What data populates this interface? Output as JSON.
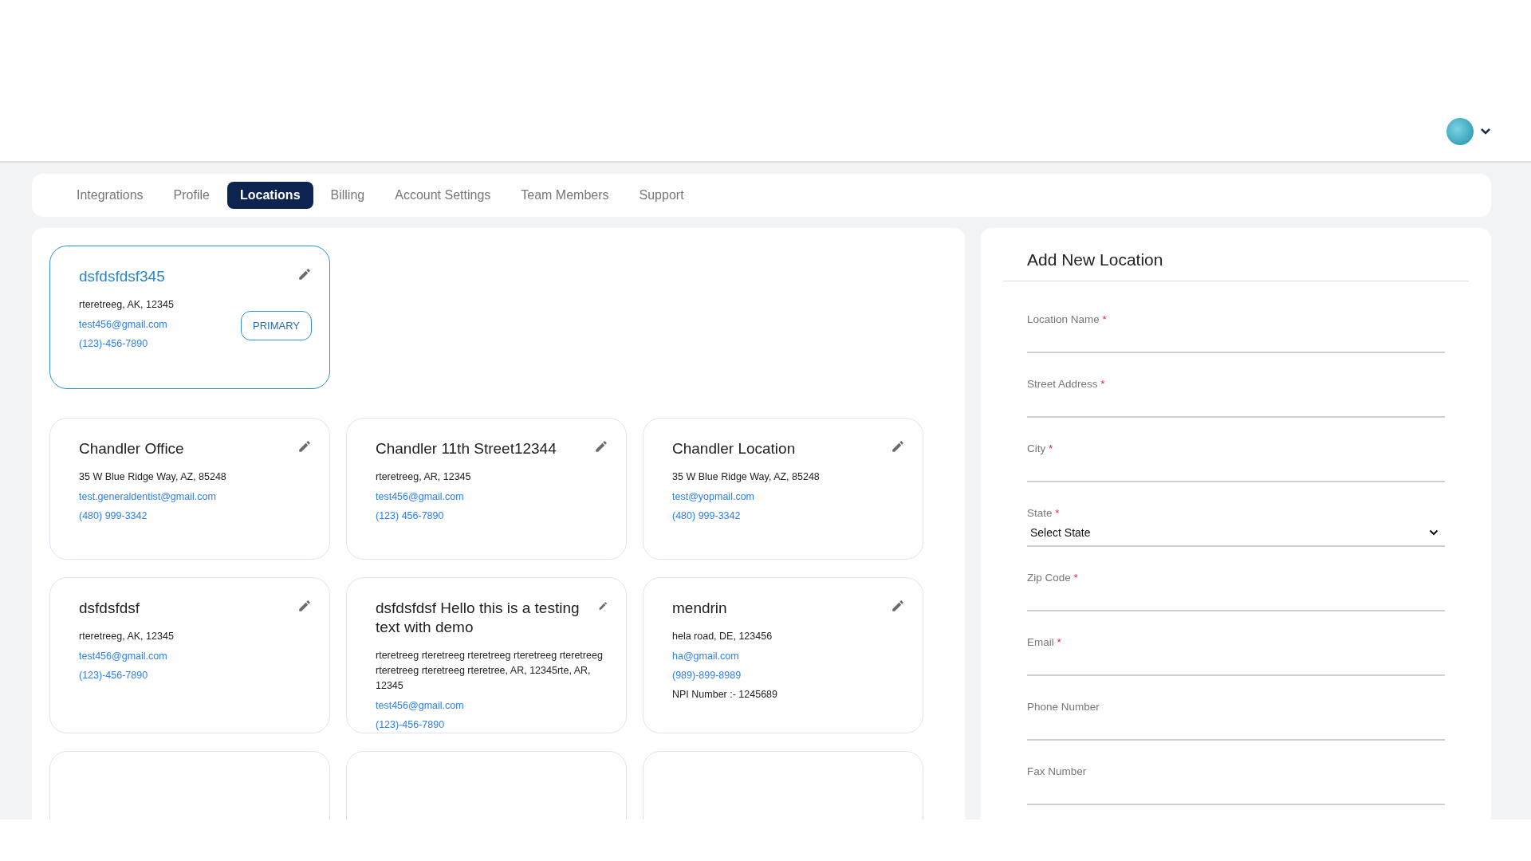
{
  "header": {
    "account_menu": {
      "expanded": false
    }
  },
  "tabs": [
    {
      "label": "Integrations",
      "selected": false
    },
    {
      "label": "Profile",
      "selected": false
    },
    {
      "label": "Locations",
      "selected": true
    },
    {
      "label": "Billing",
      "selected": false
    },
    {
      "label": "Account Settings",
      "selected": false
    },
    {
      "label": "Team Members",
      "selected": false
    },
    {
      "label": "Support",
      "selected": false
    }
  ],
  "primary_location": {
    "name": "dsfdsfdsf345",
    "address": "rteretreeg, AK, 12345",
    "email": "test456@gmail.com",
    "phone": "(123)-456-7890",
    "badge": "PRIMARY"
  },
  "locations": [
    {
      "kind": "full",
      "name": "Chandler Office",
      "address": "35 W Blue Ridge Way, AZ, 85248",
      "email": "test.generaldentist@gmail.com",
      "phone": "(480) 999-3342"
    },
    {
      "kind": "full",
      "name": "Chandler 11th Street12344",
      "address": "rteretreeg, AR, 12345",
      "email": "test456@gmail.com",
      "phone": "(123) 456-7890"
    },
    {
      "kind": "full",
      "name": "Chandler Location",
      "address": "35 W Blue Ridge Way, AZ, 85248",
      "email": "test@yopmail.com",
      "phone": "(480) 999-3342"
    },
    {
      "kind": "full",
      "name": "dsfdsfdsf",
      "address": "rteretreeg, AK, 12345",
      "email": "test456@gmail.com",
      "phone": "(123)-456-7890"
    },
    {
      "kind": "full",
      "name": "dsfdsfdsf Hello this is a testing text with demo",
      "address": "rteretreeg rteretreeg rteretreeg rteretreeg rteretreeg rteretreeg rteretreeg rteretree, AR, 12345rte, AR, 12345",
      "email": "test456@gmail.com",
      "phone": "(123)-456-7890"
    },
    {
      "kind": "full",
      "name": "mendrin",
      "address": "hela road, DE, 123456",
      "email": "ha@gmail.com",
      "phone": "(989)-899-8989",
      "note": "NPI Number :- 1245689"
    },
    {
      "kind": "cut"
    },
    {
      "kind": "cut"
    },
    {
      "kind": "cut"
    }
  ],
  "form": {
    "title": "Add New Location",
    "fields": [
      {
        "kind": "text",
        "label": "Location Name",
        "required": true
      },
      {
        "kind": "text",
        "label": "Street Address",
        "required": true
      },
      {
        "kind": "text",
        "label": "City",
        "required": true
      },
      {
        "kind": "select",
        "label": "State",
        "required": true,
        "value": "Select State"
      },
      {
        "kind": "text",
        "label": "Zip Code",
        "required": true
      },
      {
        "kind": "text",
        "label": "Email",
        "required": true
      },
      {
        "kind": "text",
        "label": "Phone Number",
        "required": false
      },
      {
        "kind": "text",
        "label": "Fax Number",
        "required": false
      }
    ],
    "required_mark": "*"
  }
}
